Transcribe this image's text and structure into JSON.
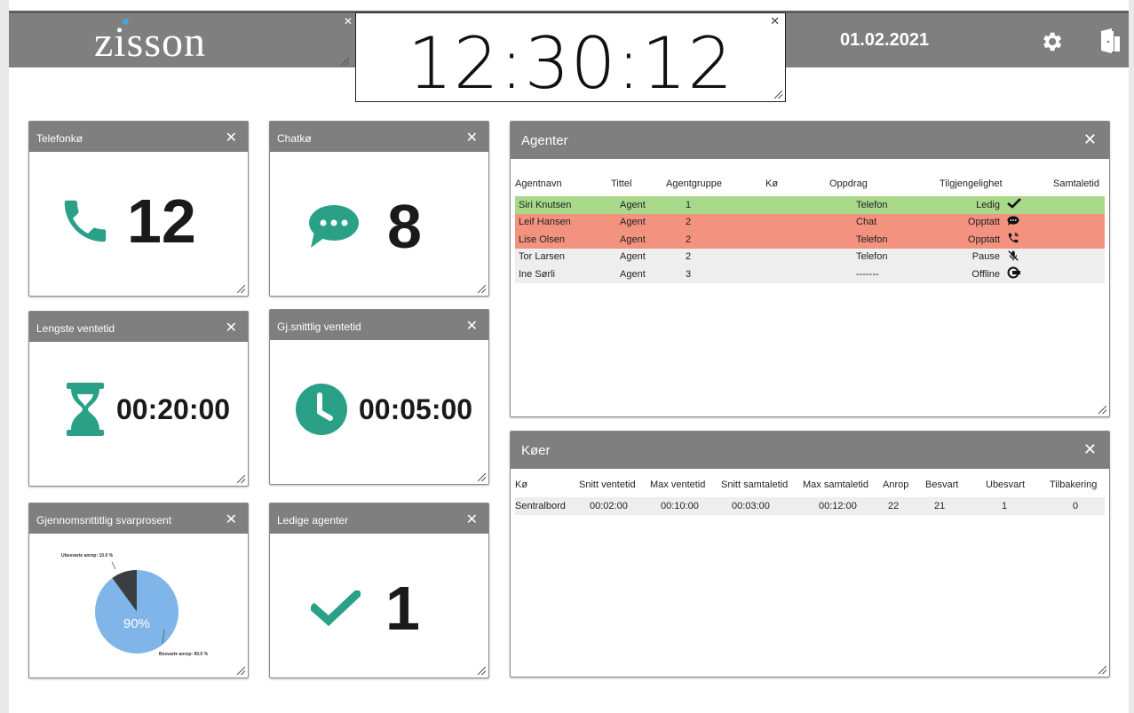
{
  "header": {
    "logo": "zisson",
    "clock": "12:30:12",
    "date": "01.02.2021"
  },
  "widgets": {
    "telefonko": {
      "title": "Telefonkø",
      "value": "12"
    },
    "chatko": {
      "title": "Chatkø",
      "value": "8"
    },
    "lengste": {
      "title": "Lengste ventetid",
      "value": "00:20:00"
    },
    "snitt": {
      "title": "Gj.snittlig ventetid",
      "value": "00:05:00"
    },
    "svarprosent": {
      "title": "Gjennomsnttitlig svarprosent",
      "label_unanswered": "Ubesvarte anrop: 10.0 %",
      "label_answered": "Besvarte anrop: 90.0 %",
      "center_label": "90%"
    },
    "ledige": {
      "title": "Ledige agenter",
      "value": "1"
    }
  },
  "agenter": {
    "title": "Agenter",
    "columns": [
      "Agentnavn",
      "Tittel",
      "Agentgruppe",
      "Kø",
      "Oppdrag",
      "Tilgjengelighet",
      "Samtaletid"
    ],
    "rows": [
      {
        "name": "Siri Knutsen",
        "title": "Agent",
        "group": "1",
        "queue": "",
        "task": "Telefon",
        "status": "Ledig",
        "icon": "check-icon",
        "color": "#a8d98a"
      },
      {
        "name": "Leif Hansen",
        "title": "Agent",
        "group": "2",
        "queue": "",
        "task": "Chat",
        "status": "Opptatt",
        "icon": "chat-bubble-icon",
        "color": "#f2927f"
      },
      {
        "name": "Lise Olsen",
        "title": "Agent",
        "group": "2",
        "queue": "",
        "task": "Telefon",
        "status": "Opptatt",
        "icon": "phone-ringing-icon",
        "color": "#f2927f"
      },
      {
        "name": "Tor Larsen",
        "title": "Agent",
        "group": "2",
        "queue": "",
        "task": "Telefon",
        "status": "Pause",
        "icon": "muted-mic-icon",
        "color": "#eeeeee"
      },
      {
        "name": "Ine Sørli",
        "title": "Agent",
        "group": "3",
        "queue": "",
        "task": "-------",
        "status": "Offline",
        "icon": "power-plug-icon",
        "color": "#eeeeee"
      }
    ]
  },
  "koer": {
    "title": "Køer",
    "columns": [
      "Kø",
      "Snitt ventetid",
      "Max ventetid",
      "Snitt samtaletid",
      "Max samtaletid",
      "Anrop",
      "Besvart",
      "Ubesvart",
      "Tilbakering"
    ],
    "rows": [
      {
        "ko": "Sentralbord",
        "snitt_vent": "00:02:00",
        "max_vent": "00:10:00",
        "snitt_samtale": "00:03:00",
        "max_samtale": "00:12:00",
        "anrop": "22",
        "besvart": "21",
        "ubesvart": "1",
        "tilbakering": "0"
      }
    ]
  },
  "chart_data": {
    "type": "pie",
    "categories": [
      "Ubesvarte anrop",
      "Besvarte anrop"
    ],
    "values": [
      10.0,
      90.0
    ],
    "colors": [
      "#3a3d42",
      "#7fb5e8"
    ]
  },
  "colors": {
    "accent": "#2aa187",
    "header": "#7f7f7f",
    "busy": "#f2927f",
    "available": "#a8d98a"
  }
}
